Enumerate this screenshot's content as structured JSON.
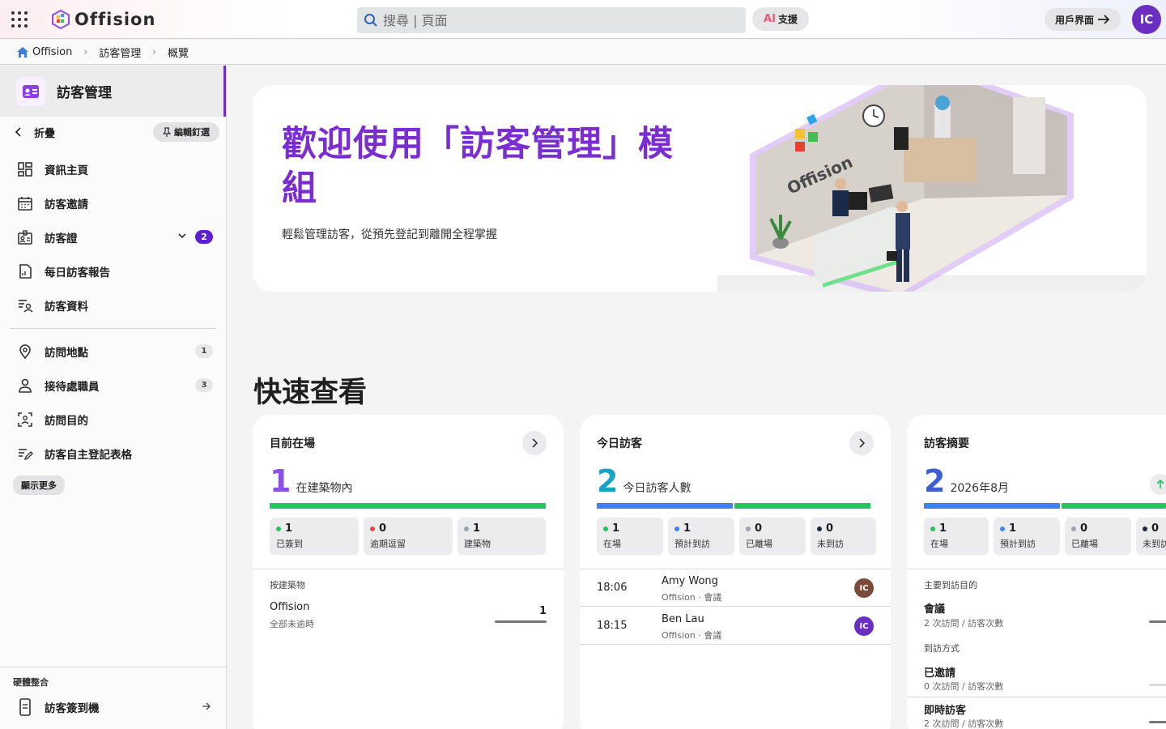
{
  "topbar": {
    "app_name": "Offision",
    "search_placeholder": "搜尋 | 頁面",
    "ai_label": "AI",
    "support_label": "支援",
    "user_ui_label": "用戶界面",
    "avatar_initials": "IC"
  },
  "breadcrumb": [
    "Offision",
    "訪客管理",
    "概覽"
  ],
  "sidebar": {
    "title": "訪客管理",
    "collapse_label": "折疊",
    "edit_pin_label": "編輯釘選",
    "items": [
      {
        "label": "資訊主頁",
        "icon": "dashboard-icon"
      },
      {
        "label": "訪客邀請",
        "icon": "calendar-icon"
      },
      {
        "label": "訪客證",
        "icon": "badge-icon",
        "badge": "2",
        "expandable": true
      },
      {
        "label": "每日訪客報告",
        "icon": "report-icon"
      },
      {
        "label": "訪客資料",
        "icon": "user-list-icon"
      }
    ],
    "items2": [
      {
        "label": "訪問地點",
        "icon": "location-pin-icon",
        "count": "1"
      },
      {
        "label": "接待處職員",
        "icon": "person-icon",
        "count": "3"
      },
      {
        "label": "訪問目的",
        "icon": "face-scan-icon"
      },
      {
        "label": "訪客自主登記表格",
        "icon": "form-edit-icon"
      }
    ],
    "show_more": "顯示更多",
    "footer_label": "硬體整合",
    "footer_item": "訪客簽到機"
  },
  "hero": {
    "title": "歡迎使用「訪客管理」模組",
    "subtitle": "輕鬆管理訪客，從預先登記到離開全程掌握",
    "image_logo_text": "Offision"
  },
  "quick_view_title": "快速查看",
  "colors": {
    "accent": "#6a2fc1",
    "green": "#22c55e",
    "blue": "#3b82f6",
    "red": "#ef4444",
    "gray": "#9ca3af",
    "dark": "#1f2937"
  },
  "cards": {
    "onsite": {
      "title": "目前在場",
      "count": "1",
      "count_label": "在建築物內",
      "stats": [
        {
          "value": "1",
          "label": "已簽到",
          "color": "#22c55e"
        },
        {
          "value": "0",
          "label": "逾期逗留",
          "color": "#ef4444"
        },
        {
          "value": "1",
          "label": "建築物",
          "color": "#9ca3af"
        }
      ],
      "section_label": "按建築物",
      "building_name": "Offision",
      "building_sub": "全部未逾時",
      "building_value": "1"
    },
    "today": {
      "title": "今日訪客",
      "count": "2",
      "count_label": "今日訪客人數",
      "stats": [
        {
          "value": "1",
          "label": "在場",
          "color": "#22c55e"
        },
        {
          "value": "1",
          "label": "預計到訪",
          "color": "#3b82f6"
        },
        {
          "value": "0",
          "label": "已離場",
          "color": "#9ca3af"
        },
        {
          "value": "0",
          "label": "未到訪",
          "color": "#1f2937"
        }
      ],
      "visitors": [
        {
          "time": "18:06",
          "name": "Amy Wong",
          "sub": "Offision · 會議",
          "initials": "IC",
          "color": "#7a4a3a"
        },
        {
          "time": "18:15",
          "name": "Ben Lau",
          "sub": "Offision · 會議",
          "initials": "IC",
          "color": "#6a2fc1"
        }
      ]
    },
    "summary": {
      "title": "訪客摘要",
      "count": "2",
      "count_label": "2026年8月",
      "stats": [
        {
          "value": "1",
          "label": "在場",
          "color": "#22c55e"
        },
        {
          "value": "1",
          "label": "預計到訪",
          "color": "#3b82f6"
        },
        {
          "value": "0",
          "label": "已離場",
          "color": "#9ca3af"
        },
        {
          "value": "0",
          "label": "未到訪",
          "color": "#1f2937"
        }
      ],
      "purpose_label": "主要到訪目的",
      "purpose_name": "會議",
      "purpose_sub": "2 次訪問 / 訪客次數",
      "method_label": "到訪方式",
      "method1_name": "已邀請",
      "method1_sub": "0 次訪問 / 訪客次數",
      "method2_name": "即時訪客",
      "method2_sub": "2 次訪問 / 訪客次數"
    }
  }
}
